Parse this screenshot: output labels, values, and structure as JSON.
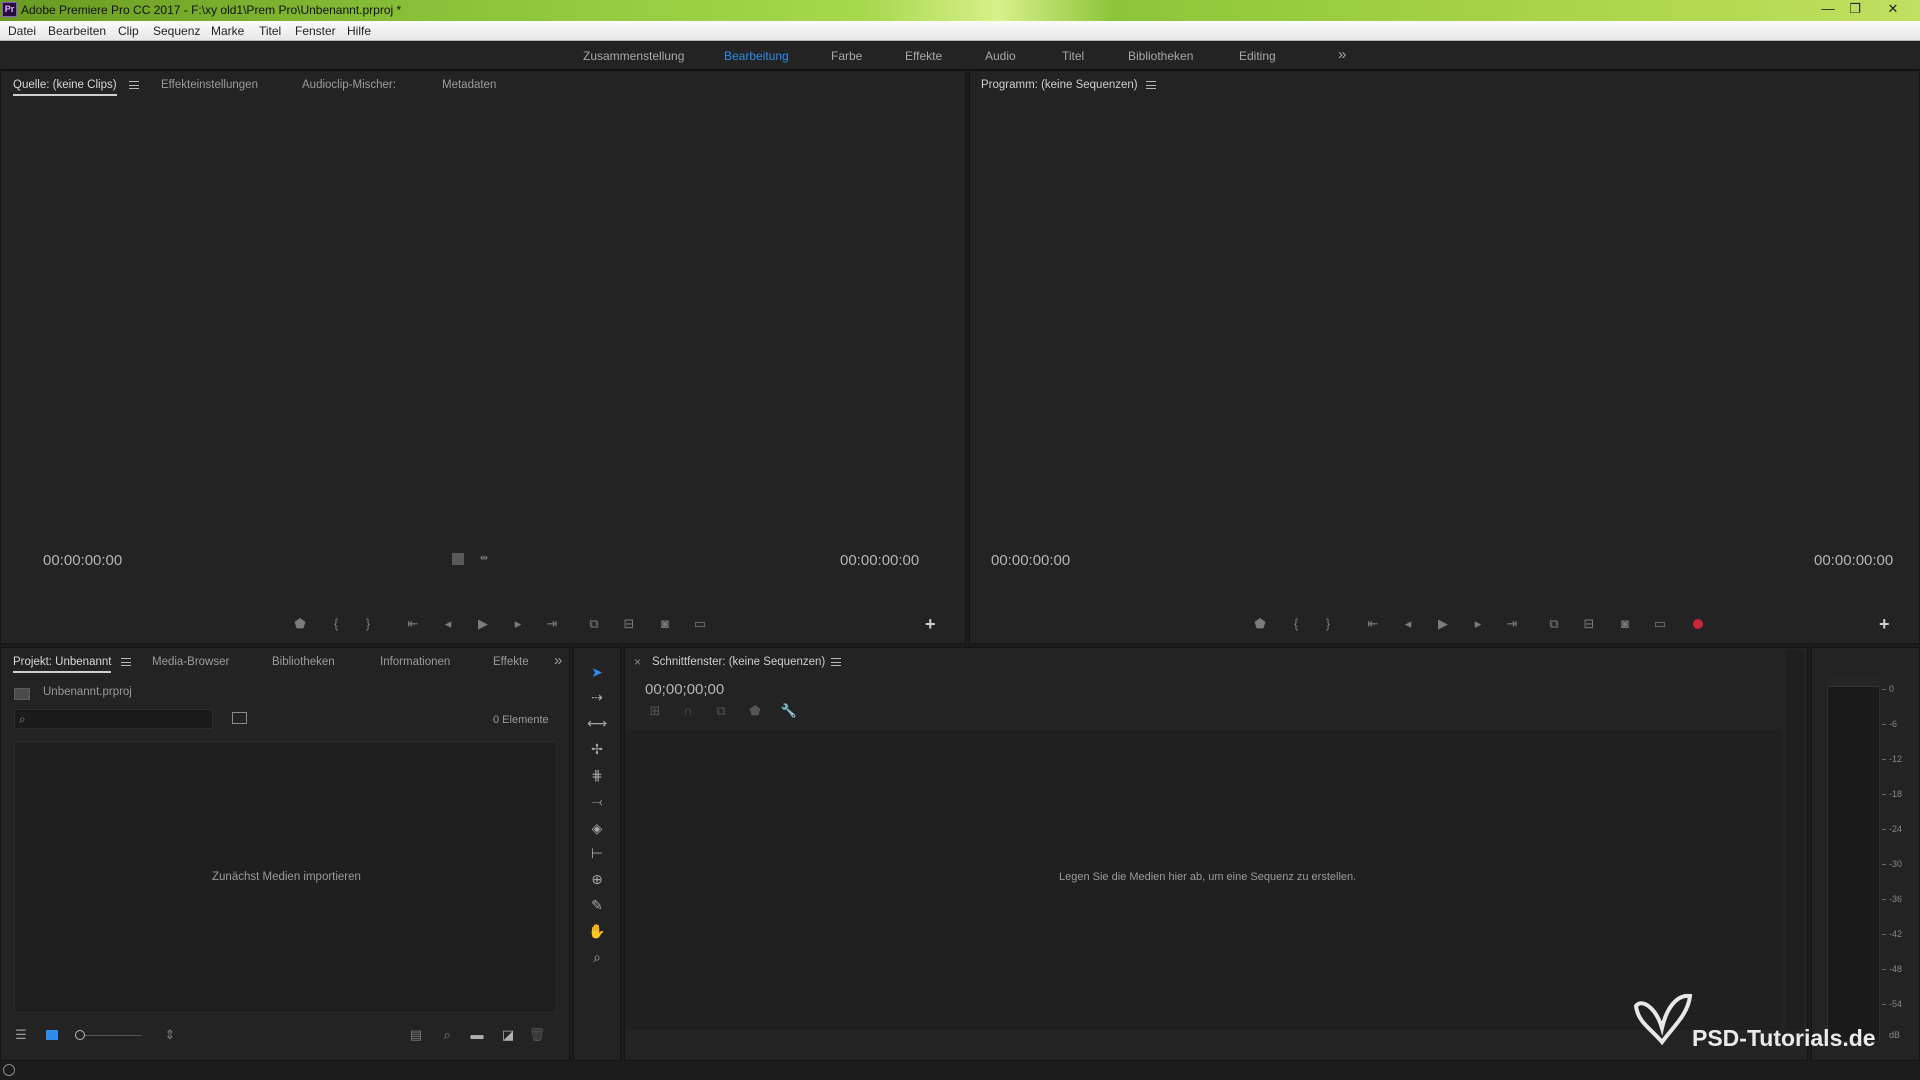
{
  "title_bar": {
    "app_icon_text": "Pr",
    "title": "Adobe Premiere Pro CC 2017 - F:\\xy old1\\Prem Pro\\Unbenannt.prproj *",
    "minimize": "—",
    "restore": "❐",
    "close": "✕"
  },
  "menu": {
    "items": [
      "Datei",
      "Bearbeiten",
      "Clip",
      "Sequenz",
      "Marke",
      "Titel",
      "Fenster",
      "Hilfe"
    ]
  },
  "workspaces": {
    "tabs": [
      "Zusammenstellung",
      "Bearbeitung",
      "Farbe",
      "Effekte",
      "Audio",
      "Titel",
      "Bibliotheken",
      "Editing"
    ],
    "active": "Bearbeitung",
    "overflow": "»"
  },
  "source_panel": {
    "tabs": [
      "Quelle: (keine Clips)",
      "Effekteinstellungen",
      "Audioclip-Mischer:",
      "Metadaten"
    ],
    "timecode_left": "00:00:00:00",
    "timecode_right": "00:00:00:00",
    "add_button": "+"
  },
  "program_panel": {
    "title": "Programm: (keine Sequenzen)",
    "timecode_left": "00:00:00:00",
    "timecode_right": "00:00:00:00",
    "add_button": "+"
  },
  "project_panel": {
    "tabs": [
      "Projekt: Unbenannt",
      "Media-Browser",
      "Bibliotheken",
      "Informationen",
      "Effekte"
    ],
    "overflow": "»",
    "project_file": "Unbenannt.prproj",
    "search_placeholder": "",
    "item_count": "0 Elemente",
    "empty_hint": "Zunächst Medien importieren"
  },
  "timeline_panel": {
    "close": "×",
    "title": "Schnittfenster: (keine Sequenzen)",
    "timecode": "00;00;00;00",
    "empty_hint": "Legen Sie die Medien hier ab, um eine Sequenz zu erstellen."
  },
  "audio_meter": {
    "labels": [
      "0",
      "-6",
      "-12",
      "-18",
      "-24",
      "-30",
      "-36",
      "-42",
      "-48",
      "-54",
      "dB"
    ]
  },
  "watermark": {
    "text": "PSD-Tutorials.de"
  },
  "colors": {
    "accent_blue": "#2d8ceb",
    "panel_bg": "#232323",
    "record_red": "#c8283c"
  },
  "icons": {
    "tools": [
      "selection-tool-icon",
      "track-select-forward-icon",
      "ripple-edit-icon",
      "rolling-edit-icon",
      "rate-stretch-icon",
      "razor-icon",
      "slip-icon",
      "slide-icon",
      "pen-icon",
      "hand-icon",
      "zoom-icon"
    ]
  }
}
